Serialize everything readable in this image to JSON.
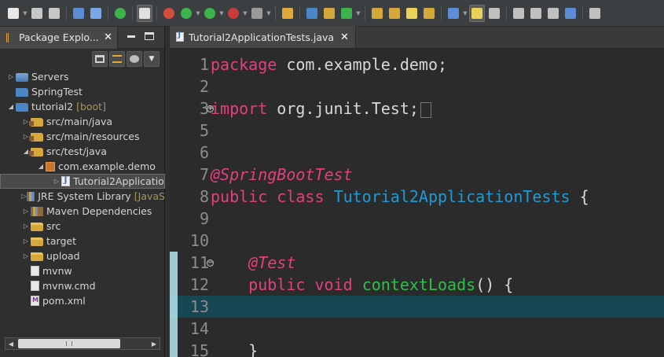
{
  "toolbar": {
    "icons": [
      "new-icon",
      "save-icon",
      "save-all-icon",
      "print-icon",
      "skip-breakpoints-icon",
      "spring-boot-icon",
      "show-whitespace-icon",
      "debug-perspective-icon",
      "run-debug-icon",
      "run-icon",
      "stop-icon",
      "external-tools-icon",
      "new-java-project-icon",
      "new-package-icon",
      "new-class-icon",
      "refresh-icon",
      "open-type-icon",
      "open-folder-icon",
      "pencil-icon",
      "open-resource-icon",
      "toggle-mark-occurrences-icon",
      "highlight-icon",
      "task-icon",
      "bookmark-icon",
      "annotation-nav-icon",
      "pin-editor-icon",
      "globe-icon",
      "search-icon"
    ],
    "colors": [
      "#e8e8e8",
      "#c7c7c7",
      "#c7c7c7",
      "#5b8ed6",
      "#7aa7e6",
      "#3cb44b",
      "#e0e0e0",
      "#d44d3b",
      "#3cb44b",
      "#3cb44b",
      "#cc3b3b",
      "#9a9a9a",
      "#e0a93b",
      "#4c86c9",
      "#d6a83b",
      "#3cb44b",
      "#d6a83b",
      "#d6a83b",
      "#e8d25a",
      "#d6a83b",
      "#5b8ed6",
      "#e8d25a",
      "#c0c0c0",
      "#c0c0c0",
      "#c0c0c0",
      "#c0c0c0",
      "#5b8ed6",
      "#c0c0c0"
    ]
  },
  "explorer": {
    "tab_label": "Package Explo...",
    "close_glyph": "✕",
    "tree": [
      {
        "label": "Servers",
        "deco": "",
        "indent": 0,
        "twisty": "▷",
        "icon": "servers-icon"
      },
      {
        "label": "SpringTest",
        "deco": "",
        "indent": 0,
        "twisty": "",
        "icon": "project-folder-icon"
      },
      {
        "label": "tutorial2",
        "deco": "[boot]",
        "indent": 0,
        "twisty": "◢",
        "icon": "project-icon"
      },
      {
        "label": "src/main/java",
        "deco": "",
        "indent": 1,
        "twisty": "▷",
        "icon": "source-folder-icon"
      },
      {
        "label": "src/main/resources",
        "deco": "",
        "indent": 1,
        "twisty": "▷",
        "icon": "source-folder-icon"
      },
      {
        "label": "src/test/java",
        "deco": "",
        "indent": 1,
        "twisty": "◢",
        "icon": "source-folder-icon"
      },
      {
        "label": "com.example.demo",
        "deco": "",
        "indent": 2,
        "twisty": "◢",
        "icon": "package-icon"
      },
      {
        "label": "Tutorial2Applicatio",
        "deco": "",
        "indent": 3,
        "twisty": "▷",
        "icon": "java-file-icon",
        "selected": true
      },
      {
        "label": "JRE System Library",
        "deco": "[JavaS",
        "indent": 1,
        "twisty": "▷",
        "icon": "library-icon"
      },
      {
        "label": "Maven Dependencies",
        "deco": "",
        "indent": 1,
        "twisty": "▷",
        "icon": "library-icon"
      },
      {
        "label": "src",
        "deco": "",
        "indent": 1,
        "twisty": "▷",
        "icon": "folder-icon"
      },
      {
        "label": "target",
        "deco": "",
        "indent": 1,
        "twisty": "▷",
        "icon": "folder-icon"
      },
      {
        "label": "upload",
        "deco": "",
        "indent": 1,
        "twisty": "▷",
        "icon": "folder-icon"
      },
      {
        "label": "mvnw",
        "deco": "",
        "indent": 1,
        "twisty": "",
        "icon": "file-icon"
      },
      {
        "label": "mvnw.cmd",
        "deco": "",
        "indent": 1,
        "twisty": "",
        "icon": "file-icon"
      },
      {
        "label": "pom.xml",
        "deco": "",
        "indent": 1,
        "twisty": "",
        "icon": "xml-file-icon"
      }
    ]
  },
  "editor": {
    "tab_label": "Tutorial2ApplicationTests.java",
    "close_glyph": "✕",
    "current_line": 13,
    "lines": [
      {
        "n": "1",
        "tokens": [
          {
            "t": "package",
            "c": "kw"
          },
          {
            "t": " com.example.demo;",
            "c": "plain"
          }
        ]
      },
      {
        "n": "2",
        "tokens": []
      },
      {
        "n": "3",
        "fold": "+",
        "tokens": [
          {
            "t": "import",
            "c": "kw"
          },
          {
            "t": " org.junit.Test;",
            "c": "plain"
          }
        ],
        "collapsed": true
      },
      {
        "n": "5",
        "tokens": []
      },
      {
        "n": "6",
        "tokens": []
      },
      {
        "n": "7",
        "tokens": [
          {
            "t": "@SpringBootTest",
            "c": "ann"
          }
        ]
      },
      {
        "n": "8",
        "tokens": [
          {
            "t": "public",
            "c": "kw"
          },
          {
            "t": " ",
            "c": "plain"
          },
          {
            "t": "class",
            "c": "kw"
          },
          {
            "t": " ",
            "c": "plain"
          },
          {
            "t": "Tutorial2ApplicationTests",
            "c": "cls"
          },
          {
            "t": " {",
            "c": "plain"
          }
        ]
      },
      {
        "n": "9",
        "tokens": []
      },
      {
        "n": "10",
        "tokens": []
      },
      {
        "n": "11",
        "fold": "−",
        "mark": true,
        "tokens": [
          {
            "t": "    ",
            "c": "plain"
          },
          {
            "t": "@Test",
            "c": "ann"
          }
        ]
      },
      {
        "n": "12",
        "mark": true,
        "tokens": [
          {
            "t": "    ",
            "c": "plain"
          },
          {
            "t": "public",
            "c": "kw"
          },
          {
            "t": " ",
            "c": "plain"
          },
          {
            "t": "void",
            "c": "kw"
          },
          {
            "t": " ",
            "c": "plain"
          },
          {
            "t": "contextLoads",
            "c": "mth"
          },
          {
            "t": "() {",
            "c": "plain"
          }
        ]
      },
      {
        "n": "13",
        "mark": true,
        "current": true,
        "tokens": []
      },
      {
        "n": "14",
        "mark": true,
        "tokens": []
      },
      {
        "n": "15",
        "mark": true,
        "tokens": [
          {
            "t": "    }",
            "c": "plain"
          }
        ]
      }
    ]
  }
}
